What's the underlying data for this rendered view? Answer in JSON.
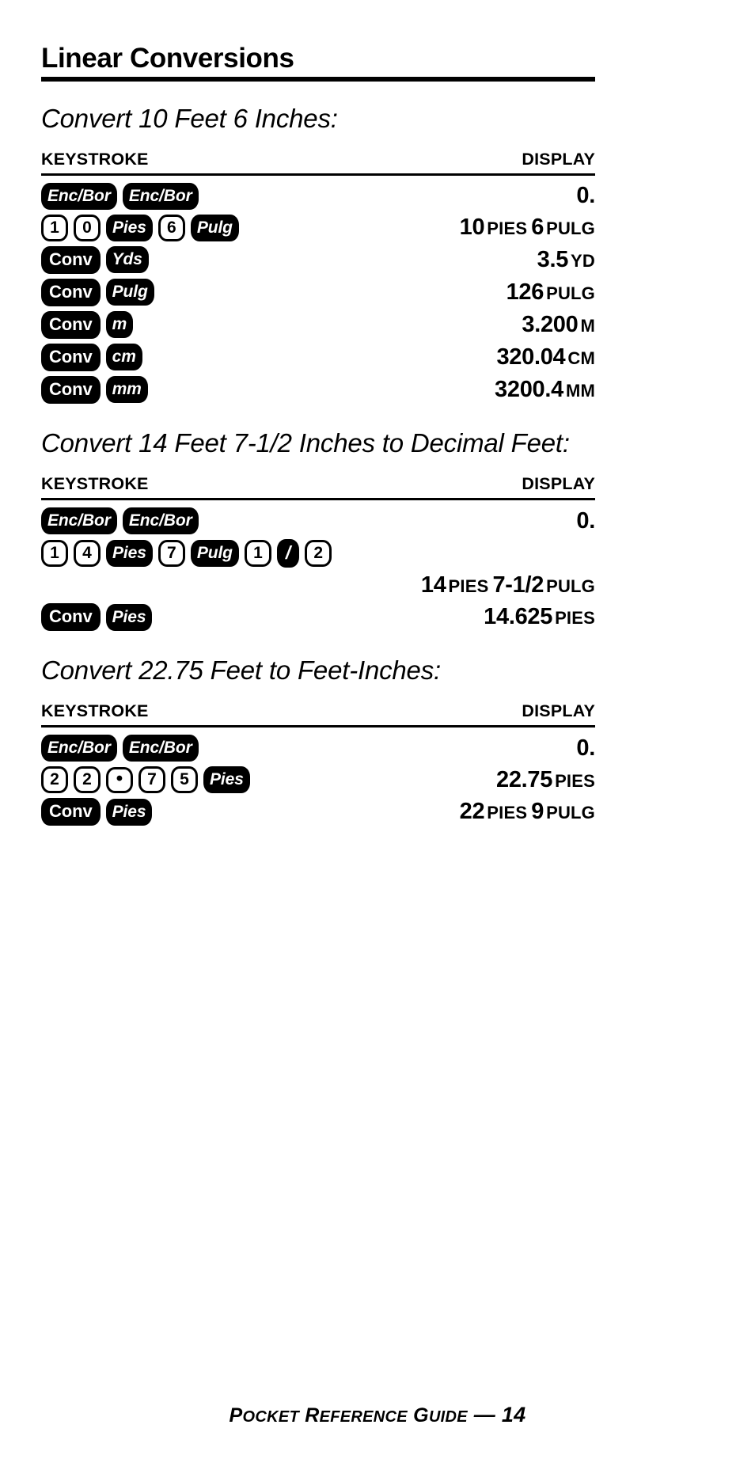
{
  "page": {
    "title": "Linear Conversions",
    "footer": {
      "text_parts": [
        "P",
        "OCKET",
        " R",
        "EFERENCE",
        " G",
        "UIDE",
        " — "
      ],
      "page_number": "14",
      "full_text": "POCKET REFERENCE GUIDE — 14"
    }
  },
  "columns": {
    "keystroke": "KEYSTROKE",
    "display": "DISPLAY"
  },
  "sections": [
    {
      "heading": "Convert 10 Feet 6 Inches:",
      "rows": [
        {
          "keys": [
            {
              "label": "Enc/Bor",
              "style": "fn"
            },
            {
              "label": "Enc/Bor",
              "style": "fn"
            }
          ],
          "display": [
            {
              "value": "0.",
              "unit": ""
            }
          ]
        },
        {
          "keys": [
            {
              "label": "1",
              "style": "num"
            },
            {
              "label": "0",
              "style": "num"
            },
            {
              "label": "Pies",
              "style": "fn"
            },
            {
              "label": "6",
              "style": "num"
            },
            {
              "label": "Pulg",
              "style": "fn"
            }
          ],
          "display": [
            {
              "value": "10",
              "unit": "PIES"
            },
            {
              "value": "6",
              "unit": "PULG"
            }
          ]
        },
        {
          "keys": [
            {
              "label": "Conv",
              "style": "fn-upright"
            },
            {
              "label": "Yds",
              "style": "fn"
            }
          ],
          "display": [
            {
              "value": "3.5",
              "unit": "YD"
            }
          ]
        },
        {
          "keys": [
            {
              "label": "Conv",
              "style": "fn-upright"
            },
            {
              "label": "Pulg",
              "style": "fn"
            }
          ],
          "display": [
            {
              "value": "126",
              "unit": "PULG"
            }
          ]
        },
        {
          "keys": [
            {
              "label": "Conv",
              "style": "fn-upright"
            },
            {
              "label": "m",
              "style": "fn"
            }
          ],
          "display": [
            {
              "value": "3.200",
              "unit": "M"
            }
          ]
        },
        {
          "keys": [
            {
              "label": "Conv",
              "style": "fn-upright"
            },
            {
              "label": "cm",
              "style": "fn"
            }
          ],
          "display": [
            {
              "value": "320.04",
              "unit": "CM"
            }
          ]
        },
        {
          "keys": [
            {
              "label": "Conv",
              "style": "fn-upright"
            },
            {
              "label": "mm",
              "style": "fn"
            }
          ],
          "display": [
            {
              "value": "3200.4",
              "unit": "MM"
            }
          ]
        }
      ]
    },
    {
      "heading": "Convert 14 Feet 7-1/2 Inches to Decimal Feet:",
      "rows": [
        {
          "keys": [
            {
              "label": "Enc/Bor",
              "style": "fn"
            },
            {
              "label": "Enc/Bor",
              "style": "fn"
            }
          ],
          "display": [
            {
              "value": "0.",
              "unit": ""
            }
          ]
        },
        {
          "keys": [
            {
              "label": "1",
              "style": "num"
            },
            {
              "label": "4",
              "style": "num"
            },
            {
              "label": "Pies",
              "style": "fn"
            },
            {
              "label": "7",
              "style": "num"
            },
            {
              "label": "Pulg",
              "style": "fn"
            },
            {
              "label": "1",
              "style": "num"
            },
            {
              "label": "/",
              "style": "fn-slash"
            },
            {
              "label": "2",
              "style": "num"
            }
          ],
          "display": []
        },
        {
          "keys": [],
          "display": [
            {
              "value": "14",
              "unit": "PIES"
            },
            {
              "value": "7-1/2",
              "unit": "PULG"
            }
          ]
        },
        {
          "keys": [
            {
              "label": "Conv",
              "style": "fn-upright"
            },
            {
              "label": "Pies",
              "style": "fn"
            }
          ],
          "display": [
            {
              "value": "14.625",
              "unit": "PIES"
            }
          ]
        }
      ]
    },
    {
      "heading": "Convert 22.75 Feet to Feet-Inches:",
      "rows": [
        {
          "keys": [
            {
              "label": "Enc/Bor",
              "style": "fn"
            },
            {
              "label": "Enc/Bor",
              "style": "fn"
            }
          ],
          "display": [
            {
              "value": "0.",
              "unit": ""
            }
          ]
        },
        {
          "keys": [
            {
              "label": "2",
              "style": "num"
            },
            {
              "label": "2",
              "style": "num"
            },
            {
              "label": "•",
              "style": "num-dot"
            },
            {
              "label": "7",
              "style": "num"
            },
            {
              "label": "5",
              "style": "num"
            },
            {
              "label": "Pies",
              "style": "fn"
            }
          ],
          "display": [
            {
              "value": "22.75",
              "unit": "PIES"
            }
          ]
        },
        {
          "keys": [
            {
              "label": "Conv",
              "style": "fn-upright"
            },
            {
              "label": "Pies",
              "style": "fn"
            }
          ],
          "display": [
            {
              "value": "22",
              "unit": "PIES"
            },
            {
              "value": "9",
              "unit": "PULG"
            }
          ]
        }
      ]
    }
  ]
}
